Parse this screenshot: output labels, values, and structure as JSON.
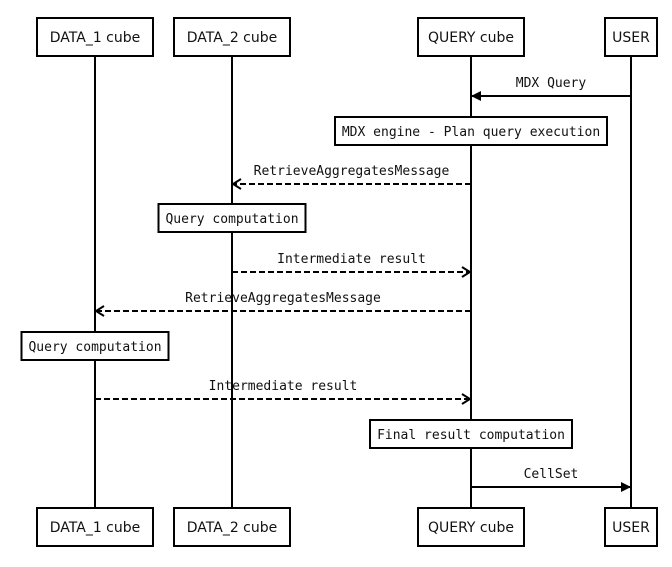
{
  "diagram": {
    "type": "sequence",
    "participants": [
      {
        "id": "data1",
        "label": "DATA_1 cube"
      },
      {
        "id": "data2",
        "label": "DATA_2 cube"
      },
      {
        "id": "query",
        "label": "QUERY cube"
      },
      {
        "id": "user",
        "label": "USER"
      }
    ],
    "steps": [
      {
        "kind": "message",
        "from": "user",
        "to": "query",
        "label": "MDX Query",
        "style": "solid"
      },
      {
        "kind": "note",
        "over": "query",
        "label": "MDX engine - Plan query execution"
      },
      {
        "kind": "message",
        "from": "query",
        "to": "data2",
        "label": "RetrieveAggregatesMessage",
        "style": "dashed"
      },
      {
        "kind": "note",
        "over": "data2",
        "label": "Query computation"
      },
      {
        "kind": "message",
        "from": "data2",
        "to": "query",
        "label": "Intermediate result",
        "style": "dashed"
      },
      {
        "kind": "message",
        "from": "query",
        "to": "data1",
        "label": "RetrieveAggregatesMessage",
        "style": "dashed"
      },
      {
        "kind": "note",
        "over": "data1",
        "label": "Query computation"
      },
      {
        "kind": "message",
        "from": "data1",
        "to": "query",
        "label": "Intermediate result",
        "style": "dashed"
      },
      {
        "kind": "note",
        "over": "query",
        "label": "Final result computation"
      },
      {
        "kind": "message",
        "from": "query",
        "to": "user",
        "label": "CellSet",
        "style": "solid"
      }
    ]
  }
}
